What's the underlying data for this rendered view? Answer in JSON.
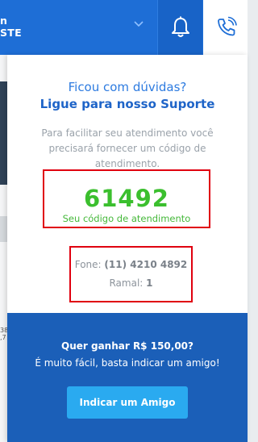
{
  "header": {
    "user_line1": "n",
    "user_line2": "STE",
    "colors": {
      "bar": "#1e6ed6",
      "active": "#1863c7"
    },
    "icons": [
      "chevron-down-icon",
      "bell-icon",
      "phone-icon"
    ]
  },
  "background": {
    "partial_text": "38 ,7"
  },
  "support": {
    "question": "Ficou com dúvidas?",
    "cta": "Ligue para nosso Suporte",
    "info": "Para facilitar seu atendimento você precisará fornecer um código de atendimento.",
    "code": "61492",
    "code_label": "Seu código de atendimento",
    "phone_label": "Fone:",
    "phone_value": "(11) 4210 4892",
    "ext_label": "Ramal:",
    "ext_value": "1"
  },
  "promo": {
    "title": "Quer ganhar R$ 150,00?",
    "subtitle": "É muito fácil, basta indicar um amigo!",
    "button_label": "Indicar um Amigo"
  }
}
